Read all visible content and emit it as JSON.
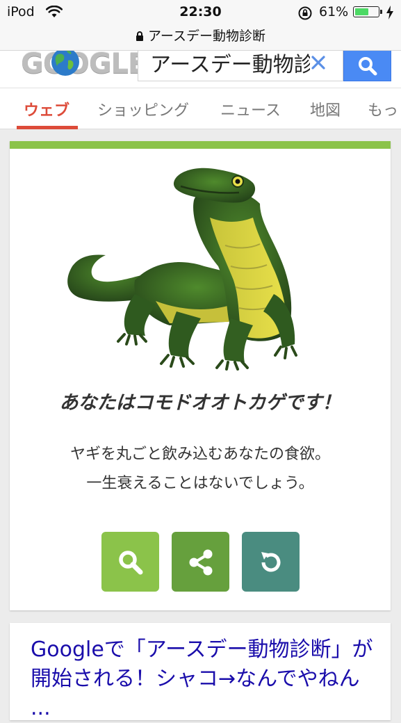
{
  "status_bar": {
    "carrier": "iPod",
    "time": "22:30",
    "battery_percent": "61%",
    "battery_level": 0.61
  },
  "url_bar": {
    "title": "アースデー動物診断"
  },
  "google_header": {
    "logo_text": "GOOGLE",
    "search_value": "アースデー動物診",
    "icons": [
      "globe-icon",
      "clear-icon",
      "search-icon"
    ]
  },
  "tabs": [
    {
      "label": "ウェブ",
      "active": true
    },
    {
      "label": "ショッピング"
    },
    {
      "label": "ニュース"
    },
    {
      "label": "地図"
    },
    {
      "label": "もっ"
    }
  ],
  "result": {
    "title": "あなたはコモドオオトカゲです！",
    "line1": "ヤギを丸ごと飲み込むあなたの食欲。",
    "line2": "一生衰えることはないでしょう。",
    "accent_color": "#8bc34a",
    "buttons": [
      {
        "icon": "search-icon",
        "color": "#8bc34a"
      },
      {
        "icon": "share-icon",
        "color": "#66a03d"
      },
      {
        "icon": "retry-icon",
        "color": "#4a8c80"
      }
    ]
  },
  "next_result": {
    "title": "Googleで「アースデー動物診断」が開始される！シャコ→なんでやねん ..."
  }
}
